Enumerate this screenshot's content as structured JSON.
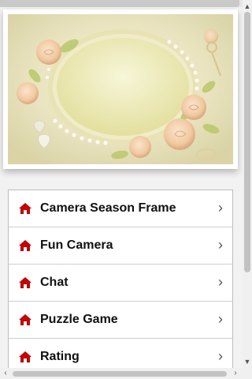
{
  "colors": {
    "accent": "#cc0000",
    "list_bg": "#ffffff",
    "page_bg": "#f2f2f2"
  },
  "banner": {
    "description_icon": "rose-frame-image"
  },
  "menu": {
    "items": [
      {
        "label": "Camera Season Frame",
        "icon": "home-icon"
      },
      {
        "label": "Fun Camera",
        "icon": "home-icon"
      },
      {
        "label": "Chat",
        "icon": "home-icon"
      },
      {
        "label": "Puzzle Game",
        "icon": "home-icon"
      },
      {
        "label": "Rating",
        "icon": "home-icon"
      }
    ],
    "chevron_glyph": "›"
  },
  "scroll": {
    "up": "▲",
    "down": "▼",
    "left": "‹",
    "right": "›"
  }
}
